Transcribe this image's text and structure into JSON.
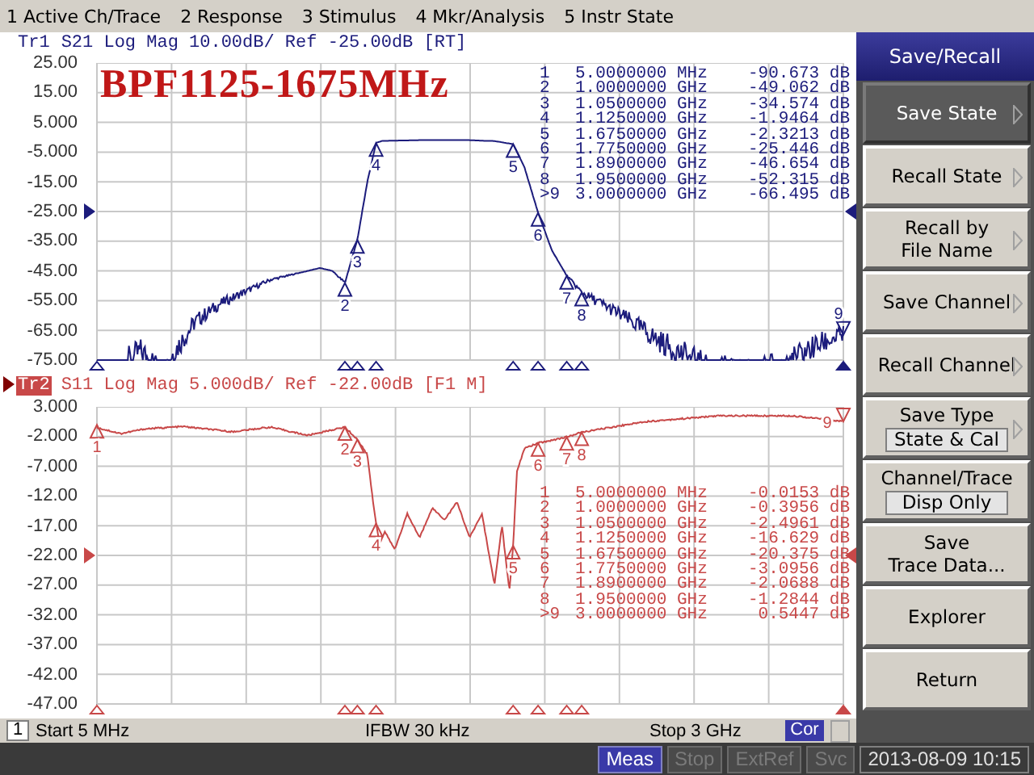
{
  "menu": [
    {
      "label": "1 Active Ch/Trace"
    },
    {
      "label": "2 Response"
    },
    {
      "label": "3 Stimulus"
    },
    {
      "label": "4 Mkr/Analysis"
    },
    {
      "label": "5 Instr State"
    }
  ],
  "traces": [
    {
      "id": "Tr1",
      "selected": false,
      "color": "#1c1c7c",
      "header": "S21 Log Mag 10.00dB/ Ref -25.00dB [RT]",
      "title": "BPF1125-1675MHz",
      "y_ticks": [
        "25.00",
        "15.00",
        "5.000",
        "-5.000",
        "-15.00",
        "-25.00",
        "-35.00",
        "-45.00",
        "-55.00",
        "-65.00",
        "-75.00"
      ],
      "markers": [
        {
          "row": "1",
          "stimulus": "5.0000000 MHz",
          "response": "-90.673 dB",
          "active": false
        },
        {
          "row": "2",
          "flag": "2",
          "stimulus": "1.0000000 GHz",
          "response": "-49.062 dB",
          "active": false
        },
        {
          "row": "3",
          "flag": "3",
          "stimulus": "1.0500000 GHz",
          "response": "-34.574 dB",
          "active": false
        },
        {
          "row": "4",
          "flag": "4",
          "stimulus": "1.1250000 GHz",
          "response": "-1.9464 dB",
          "active": false
        },
        {
          "row": "5",
          "flag": "5",
          "stimulus": "1.6750000 GHz",
          "response": "-2.3213 dB",
          "active": false
        },
        {
          "row": "6",
          "flag": "6",
          "stimulus": "1.7750000 GHz",
          "response": "-25.446 dB",
          "active": false
        },
        {
          "row": "7",
          "flag": "7",
          "stimulus": "1.8900000 GHz",
          "response": "-46.654 dB",
          "active": false
        },
        {
          "row": "8",
          "flag": "8",
          "stimulus": "1.9500000 GHz",
          "response": "-52.315 dB",
          "active": false
        },
        {
          "row": ">9",
          "flag": "9",
          "stimulus": "3.0000000 GHz",
          "response": "-66.495 dB",
          "active": true
        }
      ]
    },
    {
      "id": "Tr2",
      "selected": true,
      "color": "#c84848",
      "header": "S11 Log Mag 5.000dB/ Ref -22.00dB [F1 M]",
      "y_ticks": [
        "3.000",
        "-2.000",
        "-7.000",
        "-12.00",
        "-17.00",
        "-22.00",
        "-27.00",
        "-32.00",
        "-37.00",
        "-42.00",
        "-47.00"
      ],
      "markers": [
        {
          "row": "1",
          "flag": "1",
          "stimulus": "5.0000000 MHz",
          "response": "-0.0153 dB",
          "active": false
        },
        {
          "row": "2",
          "flag": "2",
          "stimulus": "1.0000000 GHz",
          "response": "-0.3956 dB",
          "active": false
        },
        {
          "row": "3",
          "flag": "3",
          "stimulus": "1.0500000 GHz",
          "response": "-2.4961 dB",
          "active": false
        },
        {
          "row": "4",
          "flag": "4",
          "stimulus": "1.1250000 GHz",
          "response": "-16.629 dB",
          "active": false
        },
        {
          "row": "5",
          "flag": "5",
          "stimulus": "1.6750000 GHz",
          "response": "-20.375 dB",
          "active": false
        },
        {
          "row": "6",
          "flag": "6",
          "stimulus": "1.7750000 GHz",
          "response": "-3.0956 dB",
          "active": false
        },
        {
          "row": "7",
          "flag": "7",
          "stimulus": "1.8900000 GHz",
          "response": "-2.0688 dB",
          "active": false
        },
        {
          "row": "8",
          "flag": "8",
          "stimulus": "1.9500000 GHz",
          "response": "-1.2844 dB",
          "active": false
        },
        {
          "row": ">9",
          "flag": "9",
          "stimulus": "3.0000000 GHz",
          "response": "0.5447 dB",
          "active": true
        }
      ]
    }
  ],
  "channel_bar": {
    "number": "1",
    "start": "Start 5 MHz",
    "ifbw": "IFBW 30 kHz",
    "stop": "Stop 3 GHz",
    "correction": "Cor"
  },
  "status": [
    {
      "label": "Meas",
      "on": true
    },
    {
      "label": "Stop",
      "on": false
    },
    {
      "label": "ExtRef",
      "on": false
    },
    {
      "label": "Svc",
      "on": false
    }
  ],
  "datetime": "2013-08-09 10:15",
  "softkeys": {
    "title": "Save/Recall",
    "items": [
      {
        "lines": [
          "Save State"
        ],
        "selected": true,
        "submenu": true
      },
      {
        "lines": [
          "Recall State"
        ],
        "selected": false,
        "submenu": true
      },
      {
        "lines": [
          "Recall by",
          "File Name"
        ],
        "selected": false,
        "submenu": true
      },
      {
        "lines": [
          "Save Channel"
        ],
        "selected": false,
        "submenu": true
      },
      {
        "lines": [
          "Recall Channel"
        ],
        "selected": false,
        "submenu": true
      },
      {
        "lines": [
          "Save Type"
        ],
        "value": "State & Cal",
        "selected": false,
        "submenu": true
      },
      {
        "lines": [
          "Channel/Trace"
        ],
        "value": "Disp Only",
        "selected": false,
        "submenu": false
      },
      {
        "lines": [
          "Save",
          "Trace Data..."
        ],
        "selected": false,
        "submenu": false
      },
      {
        "lines": [
          "Explorer"
        ],
        "selected": false,
        "submenu": false
      },
      {
        "lines": [
          "Return"
        ],
        "selected": false,
        "submenu": false
      }
    ]
  }
}
